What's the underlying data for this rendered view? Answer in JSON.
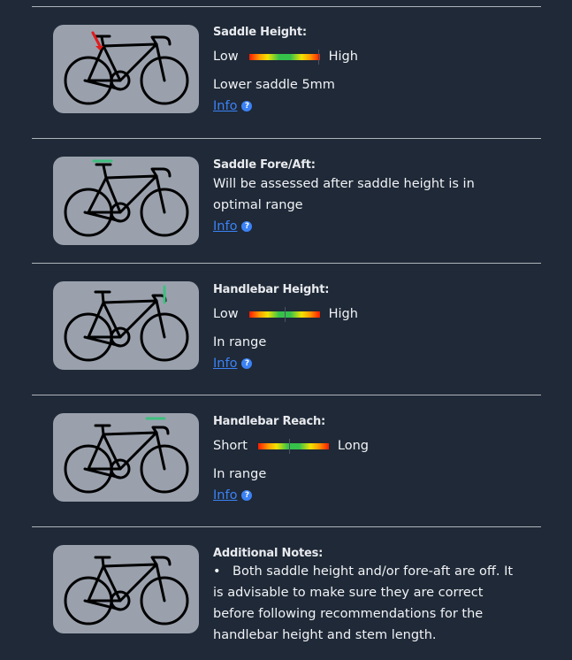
{
  "sections": [
    {
      "heading": "Saddle Height:",
      "gauge": {
        "low": "Low",
        "high": "High",
        "level": 0.98
      },
      "status": "Lower saddle 5mm",
      "info": "Info"
    },
    {
      "heading": "Saddle Fore/Aft:",
      "status": "Will be assessed after saddle height is in optimal range",
      "info": "Info"
    },
    {
      "heading": "Handlebar Height:",
      "gauge": {
        "low": "Low",
        "high": "High",
        "level": 0.5
      },
      "status": "In range",
      "info": "Info"
    },
    {
      "heading": "Handlebar Reach:",
      "gauge": {
        "low": "Short",
        "high": "Long",
        "level": 0.44
      },
      "status": "In range",
      "info": "Info"
    },
    {
      "heading": "Additional Notes:",
      "bullet": "•",
      "note": "Both saddle height and/or fore-aft are off. It is advisable to make sure they are correct before following recommendations for the handlebar height and stem length."
    }
  ],
  "help_glyph": "?",
  "colors": {
    "background": "#1f2937",
    "card": "#9aa1ad",
    "link": "#3b82f6",
    "highlight_red": "#e01b1b",
    "highlight_green": "#3fbf7f"
  },
  "icons": [
    "bike-diagram-icon",
    "help-icon"
  ]
}
